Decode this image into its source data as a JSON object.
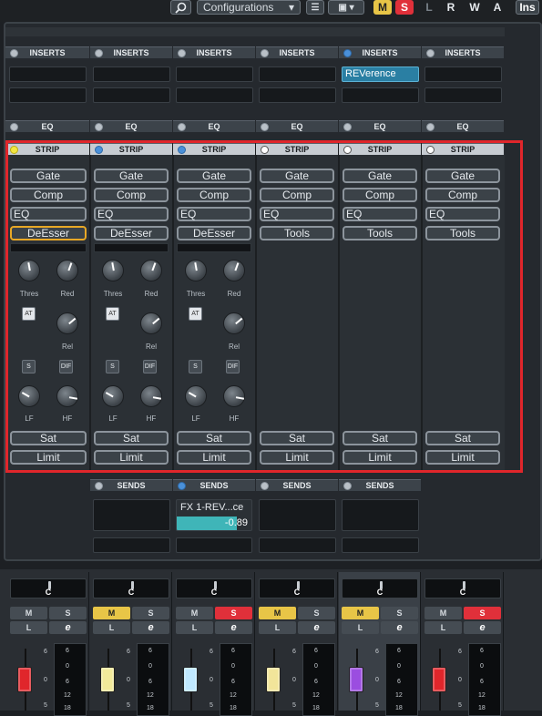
{
  "toolbar": {
    "configurations_label": "Configurations",
    "m_label": "M",
    "s_label": "S",
    "l_label": "L",
    "r_label": "R",
    "w_label": "W",
    "a_label": "A",
    "ins_label": "Ins"
  },
  "sections": {
    "inserts": "INSERTS",
    "eq": "EQ",
    "strip": "STRIP",
    "sends": "SENDS"
  },
  "inserts": {
    "reverence": "REVerence"
  },
  "strip_modules": {
    "gate": "Gate",
    "comp": "Comp",
    "eq": "EQ",
    "deesser": "DeEsser",
    "tools": "Tools",
    "sat": "Sat",
    "limit": "Limit"
  },
  "deesser_labels": {
    "thres": "Thres",
    "red": "Red",
    "at": "AT",
    "rel": "Rel",
    "s": "S",
    "dif": "DIF",
    "lf": "LF",
    "hf": "HF"
  },
  "sends": {
    "fx1_name": "FX 1-REV...ce",
    "fx1_value": "-0.89",
    "fx1_level": 0.8
  },
  "channels": [
    {
      "pan": "C",
      "m": "M",
      "s": "S",
      "l": "L",
      "e": "e",
      "mute": false,
      "solo": false,
      "fader_color": "#e0262b"
    },
    {
      "pan": "C",
      "m": "M",
      "s": "S",
      "l": "L",
      "e": "e",
      "mute": true,
      "solo": false,
      "fader_color": "#f2ea9a"
    },
    {
      "pan": "C",
      "m": "M",
      "s": "S",
      "l": "L",
      "e": "e",
      "mute": false,
      "solo": true,
      "fader_color": "#bfe8ff"
    },
    {
      "pan": "C",
      "m": "M",
      "s": "S",
      "l": "L",
      "e": "e",
      "mute": true,
      "solo": false,
      "fader_color": "#f2e59a"
    },
    {
      "pan": "C",
      "m": "M",
      "s": "S",
      "l": "L",
      "e": "e",
      "mute": true,
      "solo": false,
      "fader_color": "#9b4de0"
    },
    {
      "pan": "C",
      "m": "M",
      "s": "S",
      "l": "L",
      "e": "e",
      "mute": false,
      "solo": true,
      "fader_color": "#e0262b"
    }
  ],
  "scale": {
    "s6": "6",
    "s0": "0",
    "s5": "5",
    "m6": "6",
    "m0": "0",
    "m6b": "6",
    "m12": "12",
    "m18": "18"
  },
  "colors": {
    "highlight_red": "#e0262b",
    "accent_teal": "#3fb5b8",
    "mute_yellow": "#e8c547",
    "solo_red": "#e0303a"
  }
}
